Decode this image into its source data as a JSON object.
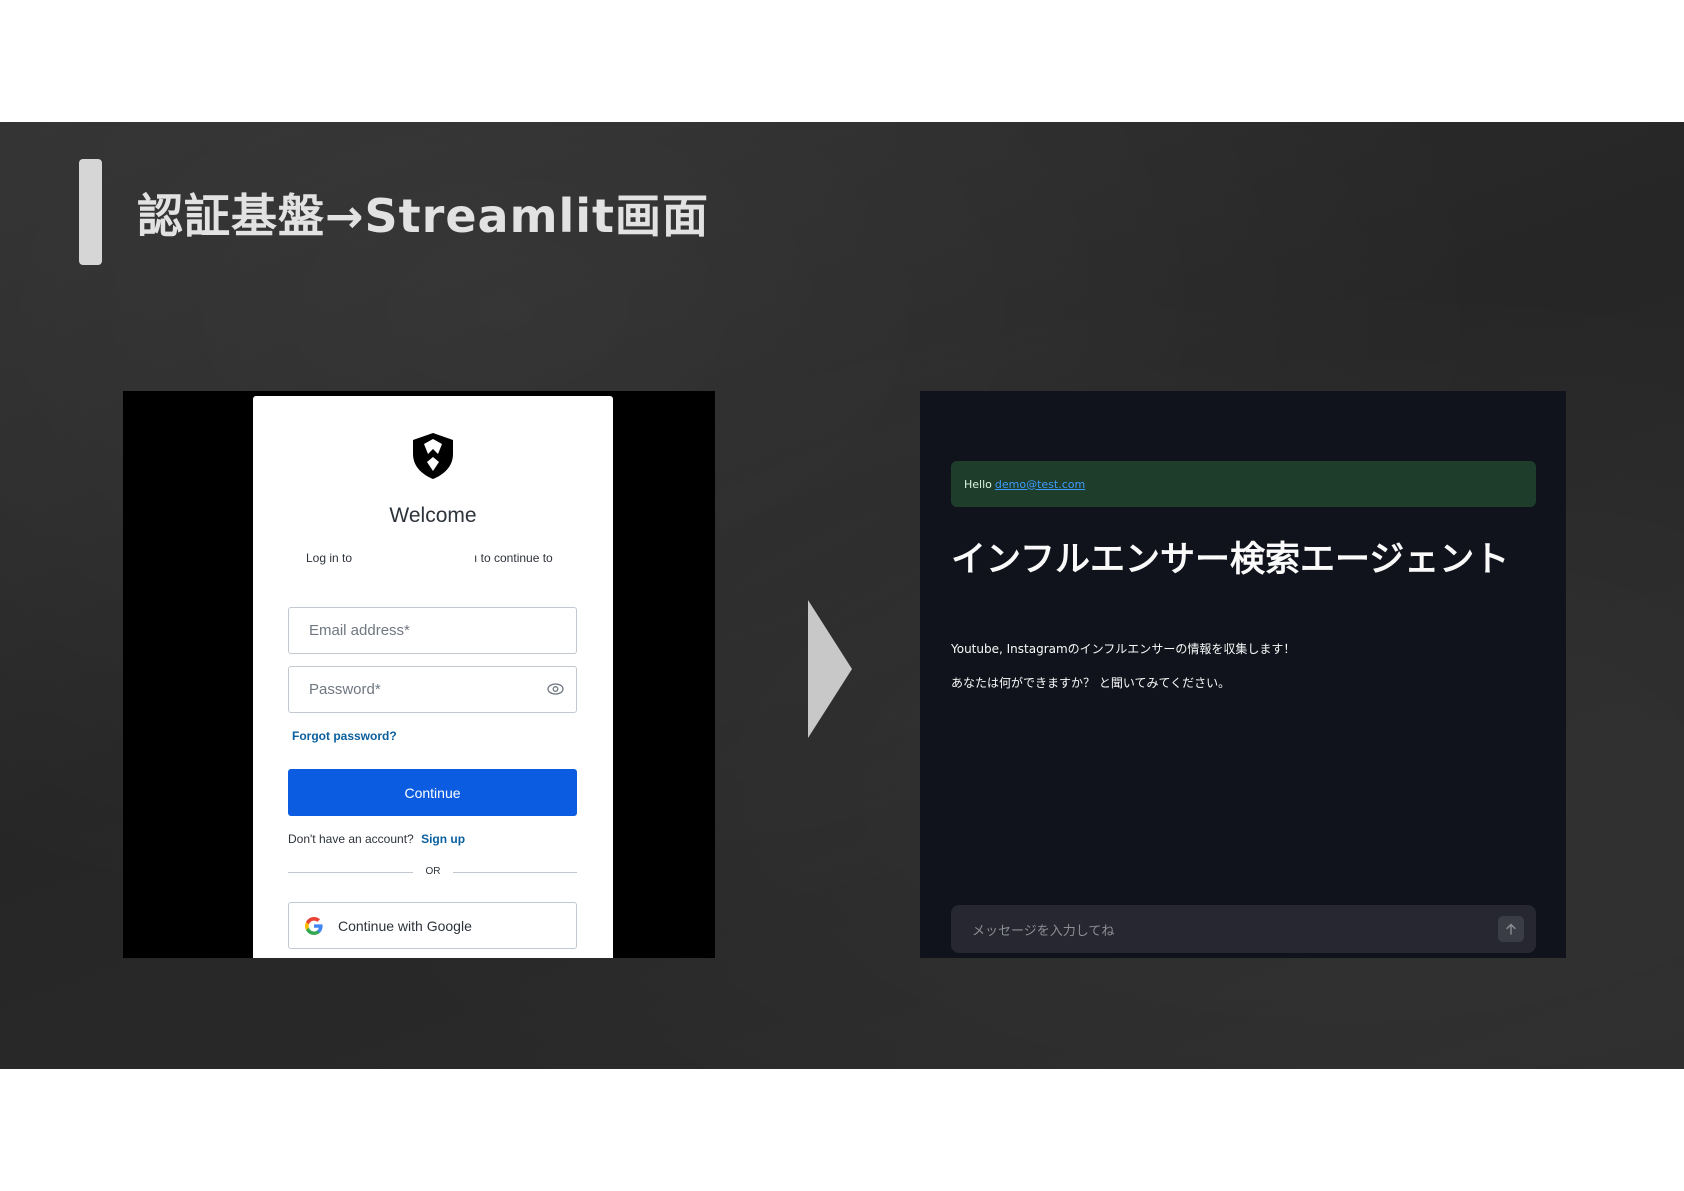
{
  "slide": {
    "title": "認証基盤→Streamlit画面"
  },
  "login": {
    "welcome": "Welcome",
    "subtitle_left": "Log in to",
    "subtitle_right": "ı to continue to",
    "email_placeholder": "Email address*",
    "password_placeholder": "Password*",
    "forgot": "Forgot password?",
    "continue_label": "Continue",
    "no_account": "Don't have an account?",
    "signup": "Sign up",
    "or": "OR",
    "google_label": "Continue with Google",
    "icons": {
      "logo": "shield-icon",
      "show_password": "eye-icon",
      "google": "google-g-icon"
    },
    "colors": {
      "primary": "#0b5ce0",
      "link": "#0a5f9e"
    }
  },
  "arrow": {
    "icon": "chevron-right-icon"
  },
  "streamlit": {
    "alert_prefix": "Hello",
    "alert_email": "demo@test.com",
    "heading": "インフルエンサー検索エージェント",
    "paragraph1": "Youtube, Instagramのインフルエンサーの情報を収集します！",
    "paragraph2": "あなたは何ができますか？ と聞いてみてください。",
    "chat_placeholder": "メッセージを入力してね",
    "send_icon": "arrow-up-icon",
    "colors": {
      "background": "#10131b",
      "success_bg": "#1f3d2b",
      "link": "#3c9cff"
    }
  }
}
